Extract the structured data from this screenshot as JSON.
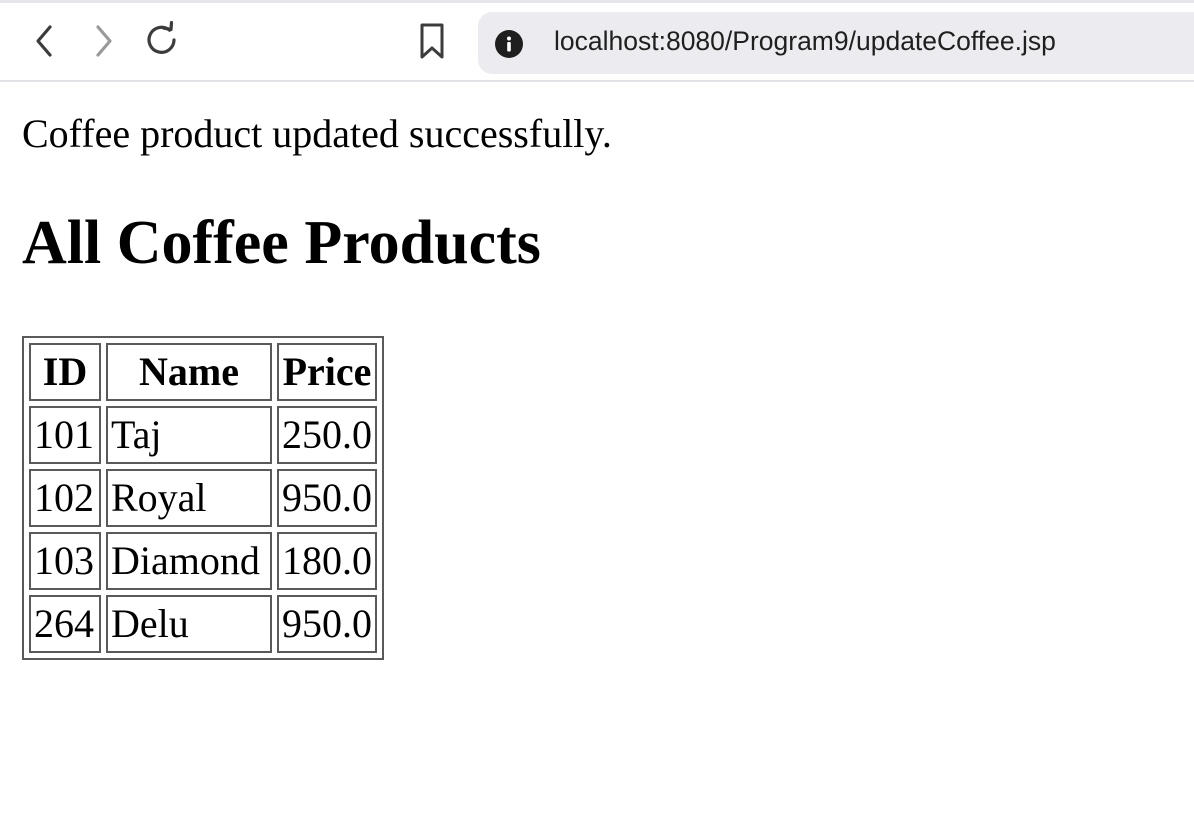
{
  "browser": {
    "url": "localhost:8080/Program9/updateCoffee.jsp",
    "back_icon": "chevron-left-icon",
    "forward_icon": "chevron-right-icon",
    "reload_icon": "reload-icon",
    "bookmark_icon": "bookmark-icon",
    "info_icon": "info-icon"
  },
  "page": {
    "message": "Coffee product updated successfully.",
    "heading": "All Coffee Products",
    "table": {
      "headers": [
        "ID",
        "Name",
        "Price"
      ],
      "rows": [
        [
          "101",
          "Taj",
          "250.0"
        ],
        [
          "102",
          "Royal",
          "950.0"
        ],
        [
          "103",
          "Diamond",
          "180.0"
        ],
        [
          "264",
          "Delu",
          "950.0"
        ]
      ]
    }
  }
}
